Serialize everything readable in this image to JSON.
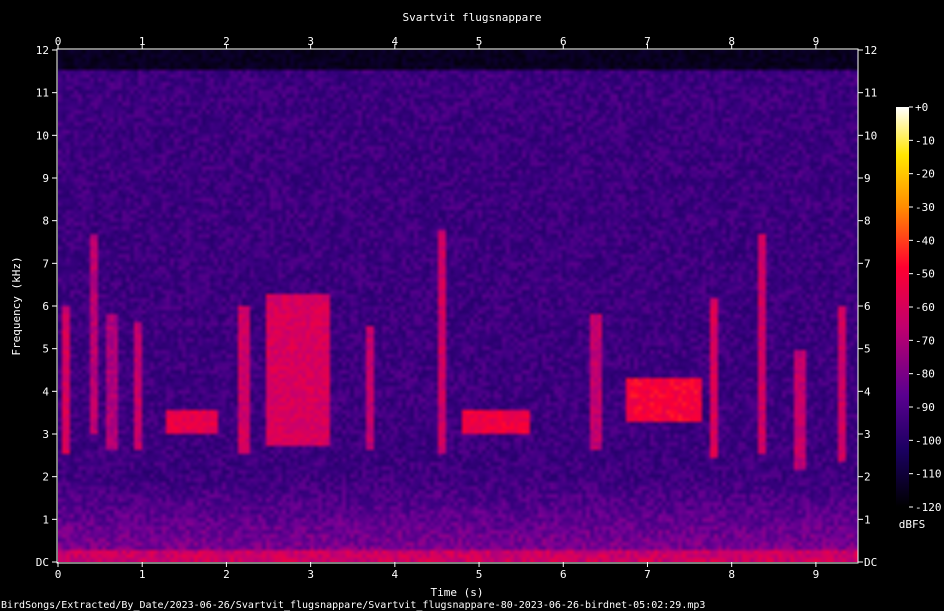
{
  "chart_data": {
    "type": "heatmap",
    "title": "Svartvit flugsnappare",
    "xlabel": "Time (s)",
    "ylabel": "Frequency (kHz)",
    "x_ticks": [
      "0",
      "1",
      "2",
      "3",
      "4",
      "5",
      "6",
      "7",
      "8",
      "9"
    ],
    "y_ticks": [
      "DC",
      "1",
      "2",
      "3",
      "4",
      "5",
      "6",
      "7",
      "8",
      "9",
      "10",
      "11",
      "12"
    ],
    "xlim": [
      0,
      9.5
    ],
    "ylim": [
      0,
      12
    ],
    "colorbar": {
      "label": "dBFS",
      "ticks": [
        "+0",
        "-10",
        "-20",
        "-30",
        "-40",
        "-50",
        "-60",
        "-70",
        "-80",
        "-90",
        "-100",
        "-110",
        "-120"
      ],
      "range": [
        -120,
        0
      ]
    },
    "signal_cutoff_khz": 11.5,
    "calls": [
      {
        "t": 0.1,
        "fmin": 2.5,
        "fmax": 6.0,
        "db": -62
      },
      {
        "t": 0.42,
        "fmin": 3.0,
        "fmax": 7.7,
        "db": -68
      },
      {
        "t": 0.65,
        "fmin": 2.6,
        "fmax": 5.8,
        "db": -70
      },
      {
        "t": 0.95,
        "fmin": 2.6,
        "fmax": 5.6,
        "db": -66
      },
      {
        "t": 1.6,
        "fmin": 3.0,
        "fmax": 3.6,
        "db": -58,
        "wide": 0.6
      },
      {
        "t": 2.2,
        "fmin": 2.5,
        "fmax": 6.0,
        "db": -64
      },
      {
        "t": 2.85,
        "fmin": 2.7,
        "fmax": 6.3,
        "db": -62,
        "wide": 0.8
      },
      {
        "t": 3.7,
        "fmin": 2.6,
        "fmax": 5.5,
        "db": -66
      },
      {
        "t": 4.55,
        "fmin": 2.5,
        "fmax": 7.8,
        "db": -64
      },
      {
        "t": 5.2,
        "fmin": 3.0,
        "fmax": 3.6,
        "db": -56,
        "wide": 0.8
      },
      {
        "t": 6.4,
        "fmin": 2.6,
        "fmax": 5.8,
        "db": -66
      },
      {
        "t": 7.2,
        "fmin": 3.3,
        "fmax": 4.3,
        "db": -54,
        "wide": 0.9
      },
      {
        "t": 7.8,
        "fmin": 2.4,
        "fmax": 6.2,
        "db": -62
      },
      {
        "t": 8.35,
        "fmin": 2.5,
        "fmax": 7.7,
        "db": -64
      },
      {
        "t": 8.8,
        "fmin": 2.2,
        "fmax": 5.0,
        "db": -66
      },
      {
        "t": 9.3,
        "fmin": 2.3,
        "fmax": 6.0,
        "db": -64
      }
    ]
  },
  "footer": {
    "filename": "BirdSongs/Extracted/By_Date/2023-06-26/Svartvit_flugsnappare/Svartvit_flugsnappare-80-2023-06-26-birdnet-05:02:29.mp3"
  }
}
